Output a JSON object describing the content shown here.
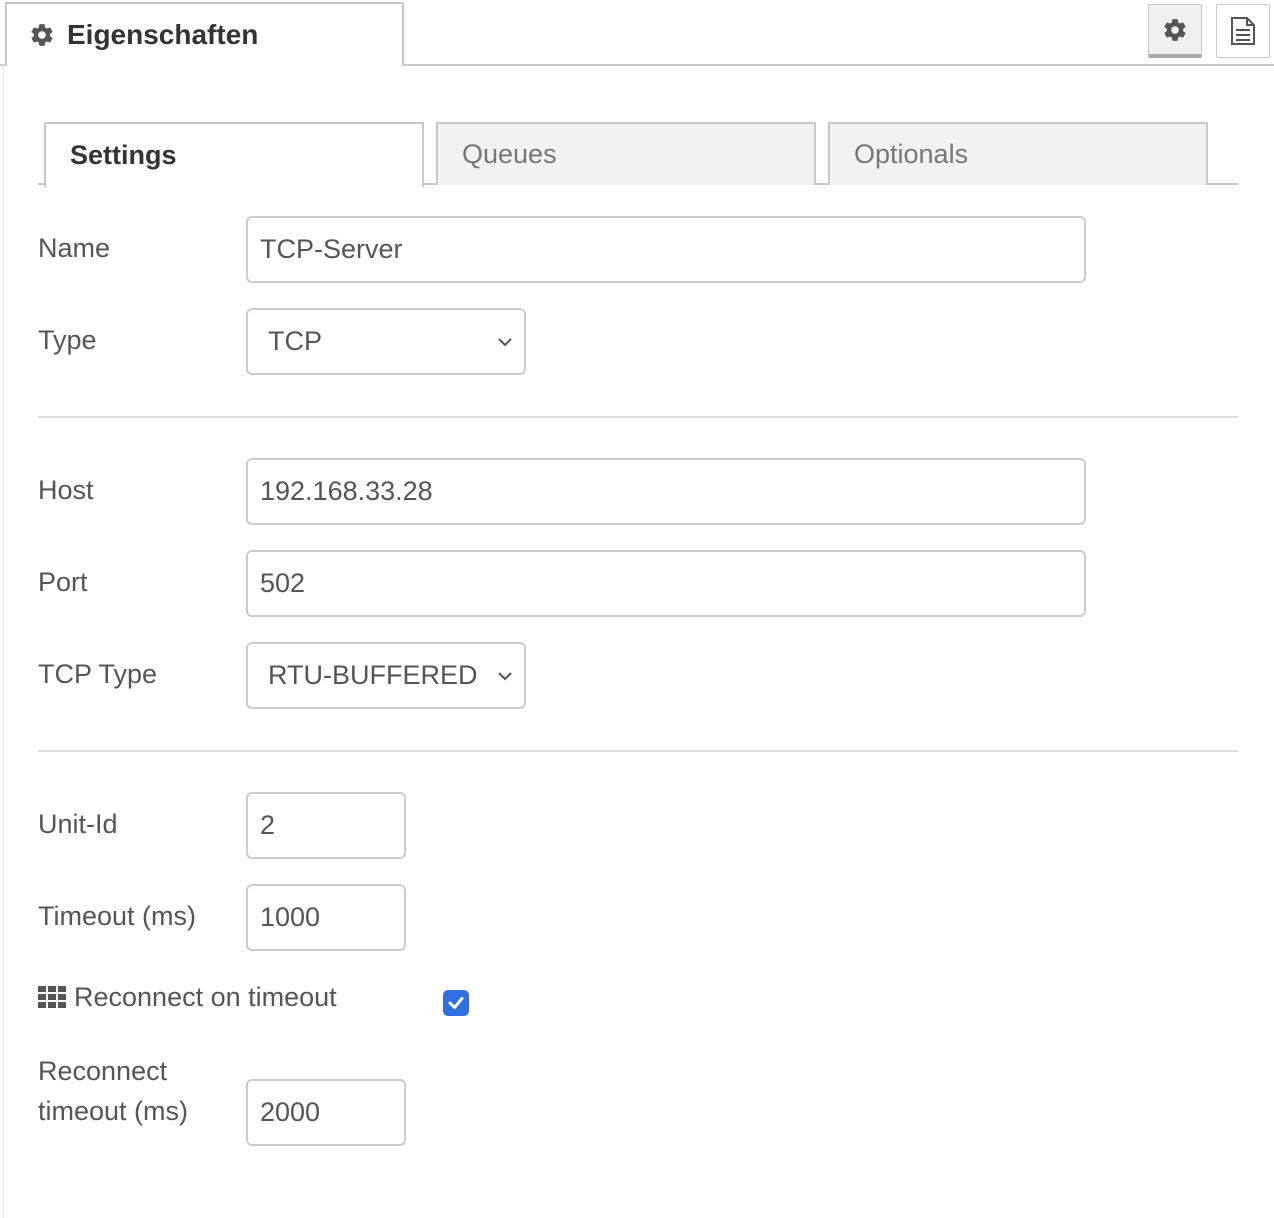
{
  "header": {
    "title": "Eigenschaften",
    "gear_icon": "gear-icon",
    "buttons": [
      {
        "icon": "gear-icon",
        "active": true
      },
      {
        "icon": "document-icon",
        "active": false
      }
    ]
  },
  "tabs": [
    {
      "label": "Settings",
      "active": true
    },
    {
      "label": "Queues",
      "active": false
    },
    {
      "label": "Optionals",
      "active": false
    }
  ],
  "form": {
    "name": {
      "label": "Name",
      "value": "TCP-Server"
    },
    "type": {
      "label": "Type",
      "value": "TCP"
    },
    "host": {
      "label": "Host",
      "value": "192.168.33.28"
    },
    "port": {
      "label": "Port",
      "value": "502"
    },
    "tcp_type": {
      "label": "TCP Type",
      "value": "RTU-BUFFERED"
    },
    "unit_id": {
      "label": "Unit-Id",
      "value": "2"
    },
    "timeout": {
      "label": "Timeout (ms)",
      "value": "1000"
    },
    "reconnect_on_timeout": {
      "label": "Reconnect on timeout",
      "icon": "grid-icon",
      "checked": true
    },
    "reconnect_timeout": {
      "label_line1": "Reconnect",
      "label_line2": "timeout (ms)",
      "value": "2000"
    }
  },
  "colors": {
    "accent": "#2f6fdf",
    "border": "#c8c8c8",
    "text": "#555555"
  }
}
